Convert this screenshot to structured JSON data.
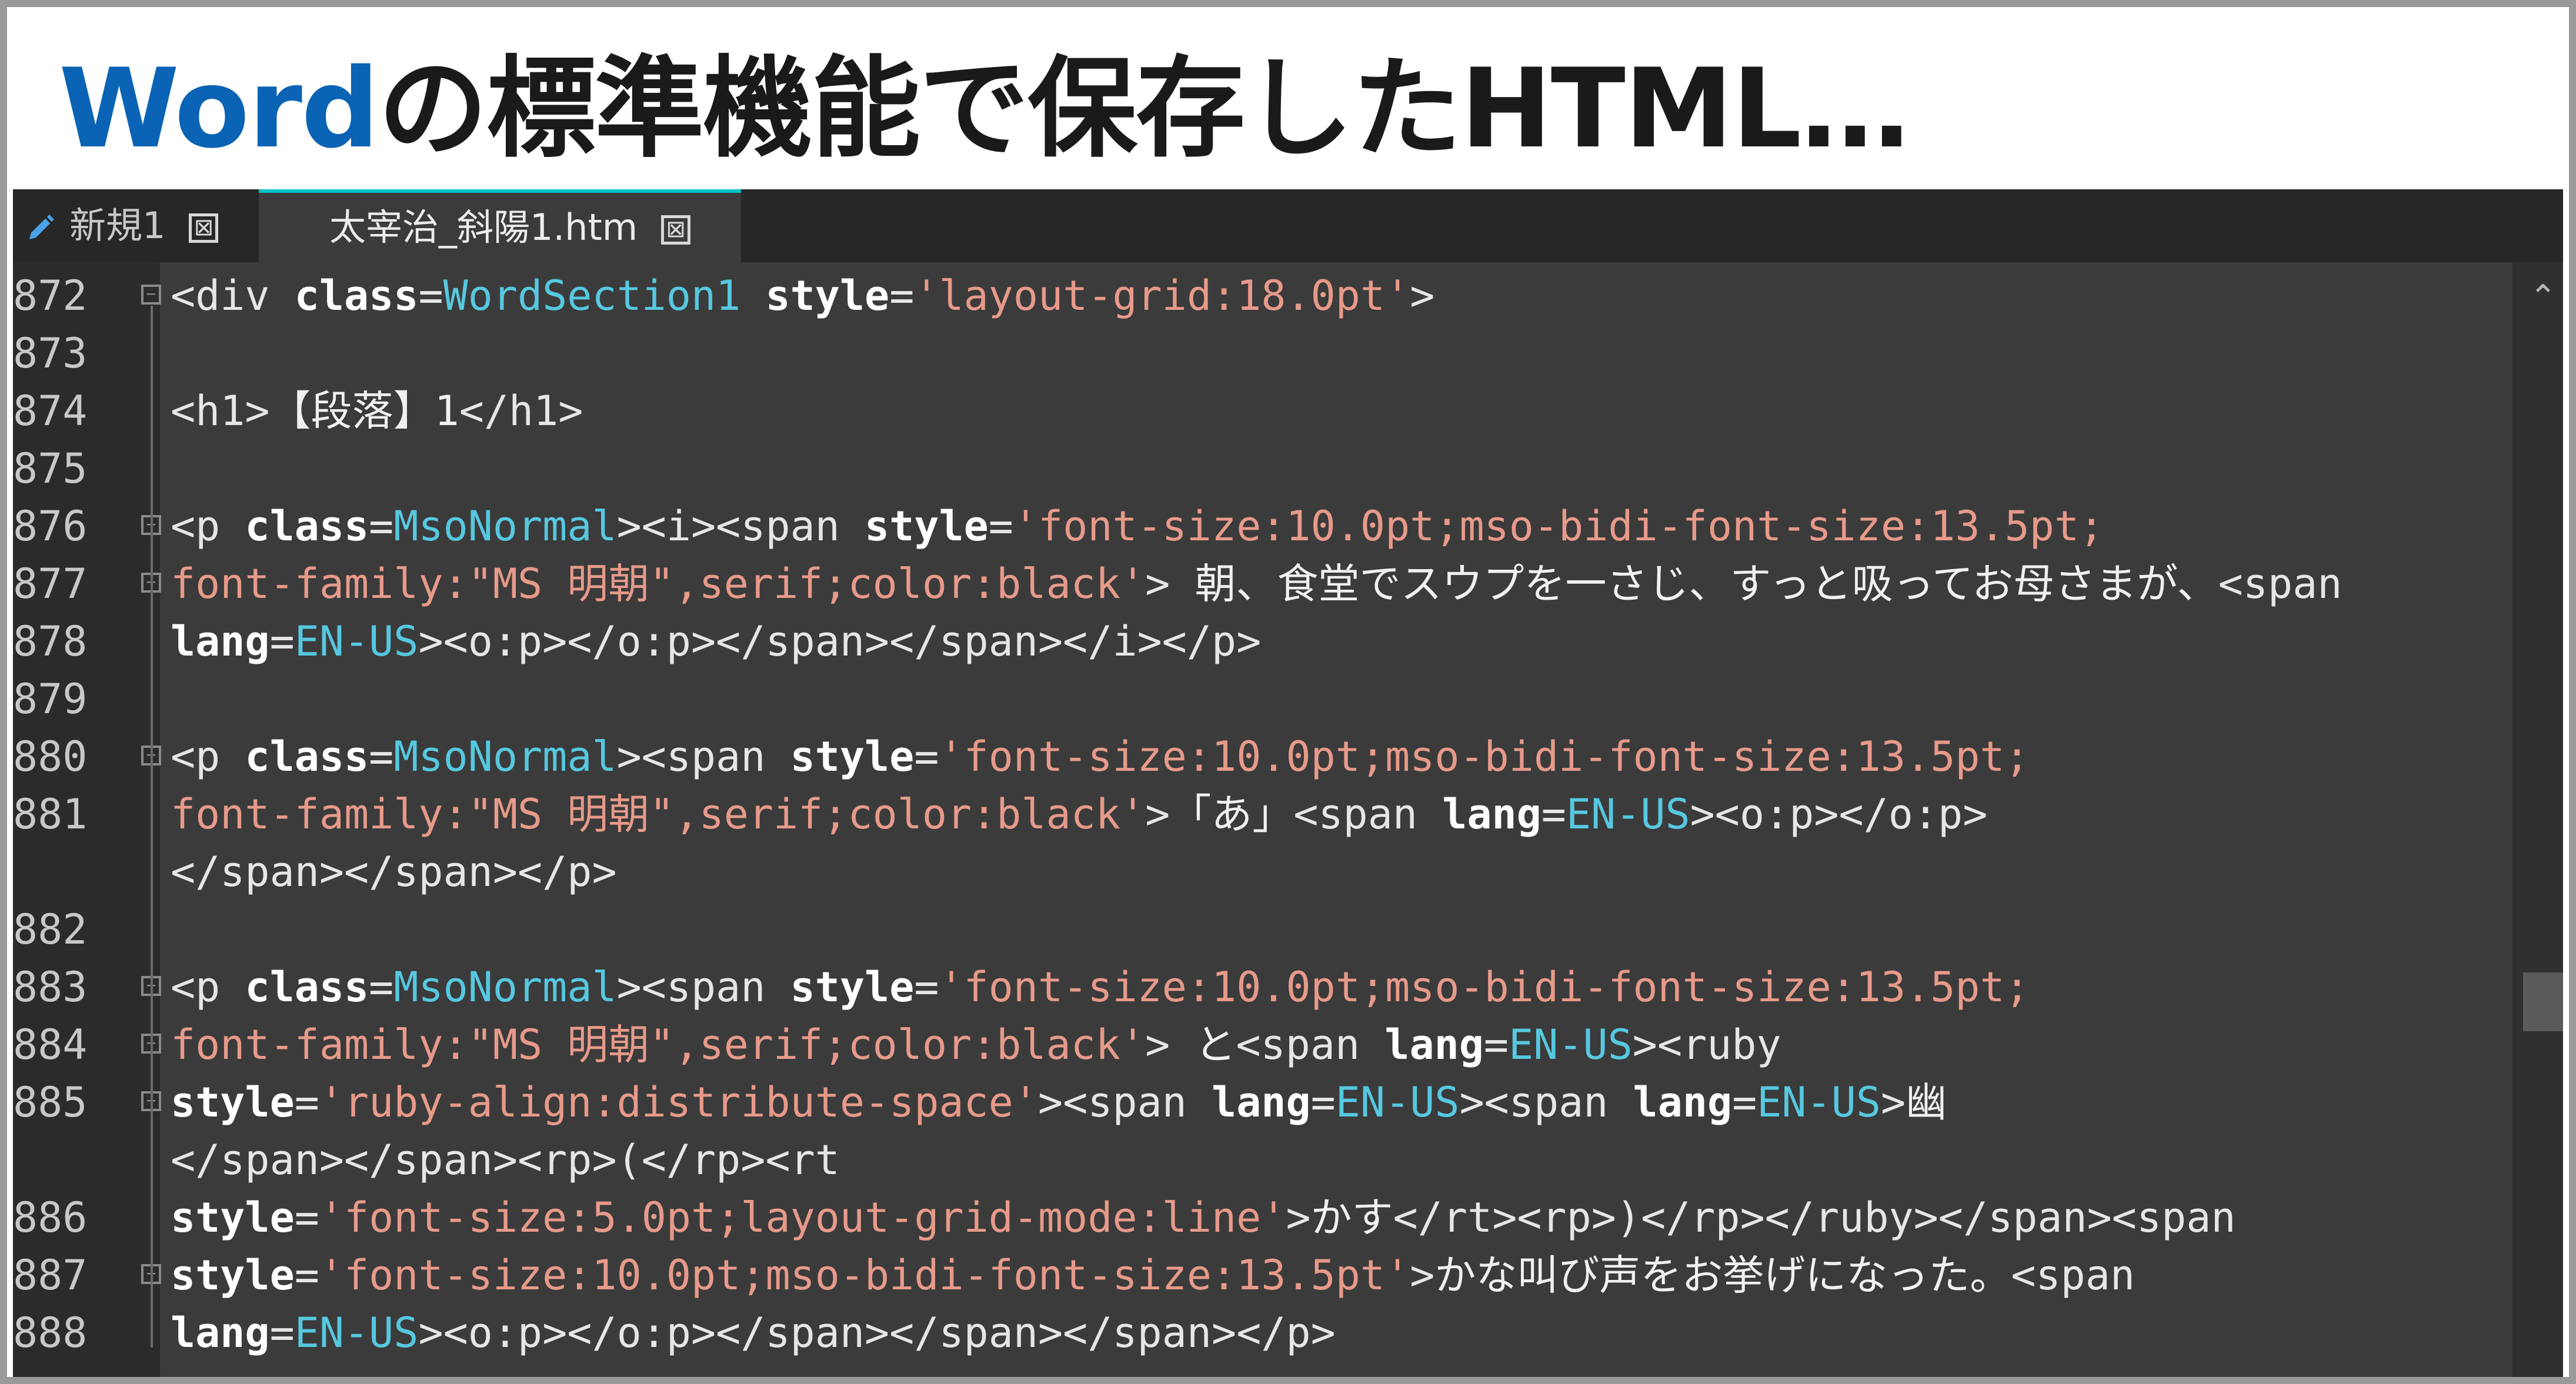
{
  "headline": {
    "accent": "Word",
    "rest": "の標準機能で保存したHTML…"
  },
  "tabs": [
    {
      "label": "新規1",
      "icon": "pencil-icon",
      "close": "⊠"
    },
    {
      "label": "太宰治_斜陽1.htm",
      "close": "⊠"
    }
  ],
  "lines": [
    {
      "num": "872",
      "fold": "open",
      "tokens": [
        [
          "tg",
          "<div "
        ],
        [
          "at",
          "class"
        ],
        [
          "eq",
          "="
        ],
        [
          "vl",
          "WordSection1"
        ],
        [
          "tg",
          " "
        ],
        [
          "at",
          "style"
        ],
        [
          "eq",
          "="
        ],
        [
          "st",
          "'layout-grid:18.0pt'"
        ],
        [
          "tg",
          ">"
        ]
      ]
    },
    {
      "num": "873",
      "tokens": []
    },
    {
      "num": "874",
      "tokens": [
        [
          "tg",
          "<h1>"
        ],
        [
          "tx",
          "【段落】1"
        ],
        [
          "tg",
          "</h1>"
        ]
      ]
    },
    {
      "num": "875",
      "tokens": []
    },
    {
      "num": "876",
      "fold": "open",
      "tokens": [
        [
          "tg",
          "<p "
        ],
        [
          "at",
          "class"
        ],
        [
          "eq",
          "="
        ],
        [
          "vl",
          "MsoNormal"
        ],
        [
          "tg",
          "><i><span "
        ],
        [
          "at",
          "style"
        ],
        [
          "eq",
          "="
        ],
        [
          "st",
          "'font-size:10.0pt;mso-bidi-font-size:13.5pt;"
        ]
      ]
    },
    {
      "num": "877",
      "fold": "open",
      "tokens": [
        [
          "st",
          "font-family:\"MS 明朝\",serif;color:black'"
        ],
        [
          "tg",
          "> "
        ],
        [
          "tx",
          "朝、食堂でスウプを一さじ、すっと吸ってお母さまが、"
        ],
        [
          "tg",
          "<span"
        ]
      ]
    },
    {
      "num": "878",
      "tokens": [
        [
          "at",
          "lang"
        ],
        [
          "eq",
          "="
        ],
        [
          "vl",
          "EN-US"
        ],
        [
          "tg",
          "><o:p></o:p></span></span></i></p>"
        ]
      ]
    },
    {
      "num": "879",
      "tokens": []
    },
    {
      "num": "880",
      "fold": "open",
      "tokens": [
        [
          "tg",
          "<p "
        ],
        [
          "at",
          "class"
        ],
        [
          "eq",
          "="
        ],
        [
          "vl",
          "MsoNormal"
        ],
        [
          "tg",
          "><span "
        ],
        [
          "at",
          "style"
        ],
        [
          "eq",
          "="
        ],
        [
          "st",
          "'font-size:10.0pt;mso-bidi-font-size:13.5pt;"
        ]
      ]
    },
    {
      "num": "881",
      "tokens": [
        [
          "st",
          "font-family:\"MS 明朝\",serif;color:black'"
        ],
        [
          "tg",
          ">"
        ],
        [
          "tx",
          "「あ」"
        ],
        [
          "tg",
          "<span "
        ],
        [
          "at",
          "lang"
        ],
        [
          "eq",
          "="
        ],
        [
          "vl",
          "EN-US"
        ],
        [
          "tg",
          "><o:p></o:p>"
        ]
      ]
    },
    {
      "num": "",
      "tokens": [
        [
          "tg",
          "</span></span></p>"
        ]
      ]
    },
    {
      "num": "882",
      "tokens": []
    },
    {
      "num": "883",
      "fold": "open",
      "tokens": [
        [
          "tg",
          "<p "
        ],
        [
          "at",
          "class"
        ],
        [
          "eq",
          "="
        ],
        [
          "vl",
          "MsoNormal"
        ],
        [
          "tg",
          "><span "
        ],
        [
          "at",
          "style"
        ],
        [
          "eq",
          "="
        ],
        [
          "st",
          "'font-size:10.0pt;mso-bidi-font-size:13.5pt;"
        ]
      ]
    },
    {
      "num": "884",
      "fold": "open",
      "tokens": [
        [
          "st",
          "font-family:\"MS 明朝\",serif;color:black'"
        ],
        [
          "tg",
          "> "
        ],
        [
          "tx",
          "と"
        ],
        [
          "tg",
          "<span "
        ],
        [
          "at",
          "lang"
        ],
        [
          "eq",
          "="
        ],
        [
          "vl",
          "EN-US"
        ],
        [
          "tg",
          "><ruby"
        ]
      ]
    },
    {
      "num": "885",
      "fold": "open",
      "tokens": [
        [
          "at",
          "style"
        ],
        [
          "eq",
          "="
        ],
        [
          "st",
          "'ruby-align:distribute-space'"
        ],
        [
          "tg",
          "><span "
        ],
        [
          "at",
          "lang"
        ],
        [
          "eq",
          "="
        ],
        [
          "vl",
          "EN-US"
        ],
        [
          "tg",
          "><span "
        ],
        [
          "at",
          "lang"
        ],
        [
          "eq",
          "="
        ],
        [
          "vl",
          "EN-US"
        ],
        [
          "tg",
          ">"
        ],
        [
          "tx",
          "幽"
        ]
      ]
    },
    {
      "num": "",
      "tokens": [
        [
          "tg",
          "</span></span><rp>(</rp><rt"
        ]
      ]
    },
    {
      "num": "886",
      "tokens": [
        [
          "at",
          "style"
        ],
        [
          "eq",
          "="
        ],
        [
          "st",
          "'font-size:5.0pt;layout-grid-mode:line'"
        ],
        [
          "tg",
          ">"
        ],
        [
          "tx",
          "かす"
        ],
        [
          "tg",
          "</rt><rp>)</rp></ruby></span><span"
        ]
      ]
    },
    {
      "num": "887",
      "fold": "open",
      "tokens": [
        [
          "at",
          "style"
        ],
        [
          "eq",
          "="
        ],
        [
          "st",
          "'font-size:10.0pt;mso-bidi-font-size:13.5pt'"
        ],
        [
          "tg",
          ">"
        ],
        [
          "tx",
          "かな叫び声をお挙げになった。"
        ],
        [
          "tg",
          "<span"
        ]
      ]
    },
    {
      "num": "888",
      "tokens": [
        [
          "at",
          "lang"
        ],
        [
          "eq",
          "="
        ],
        [
          "vl",
          "EN-US"
        ],
        [
          "tg",
          "><o:p></o:p></span></span></span></p>"
        ]
      ]
    }
  ],
  "colors": {
    "accent": "#0a63b4",
    "editor_bg": "#3b3b3b",
    "gutter_bg": "#2b2b2b",
    "tag": "#e6e6e6",
    "attr": "#ffffff",
    "value": "#56c8e0",
    "string": "#e79a8a"
  }
}
